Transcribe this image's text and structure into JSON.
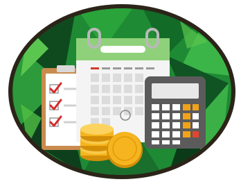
{
  "illustration": {
    "subject": [
      "calendar",
      "checklist",
      "calculator",
      "coins"
    ],
    "colors": {
      "frame": "#2b2418",
      "bg_dark": "#0f4a1f",
      "bg_mid": "#1f8a34",
      "bg_light": "#4fbf45",
      "calendar_header": "#8fd17a",
      "calendar_body": "#f4f4f4",
      "calendar_grid": "#dcdcdc",
      "calendar_ring": "#b9b9b9",
      "calendar_red": "#d23a2a",
      "clipboard": "#c98b4e",
      "paper": "#ffffff",
      "check": "#d62a2a",
      "calculator_body": "#5b5b5b",
      "calculator_screen": "#e8e8e8",
      "calculator_key": "#ffffff",
      "calculator_key_orange": "#f1a21a",
      "calculator_key_red": "#e5432c",
      "coin": "#f6b51e",
      "coin_dark": "#d48f08"
    }
  }
}
